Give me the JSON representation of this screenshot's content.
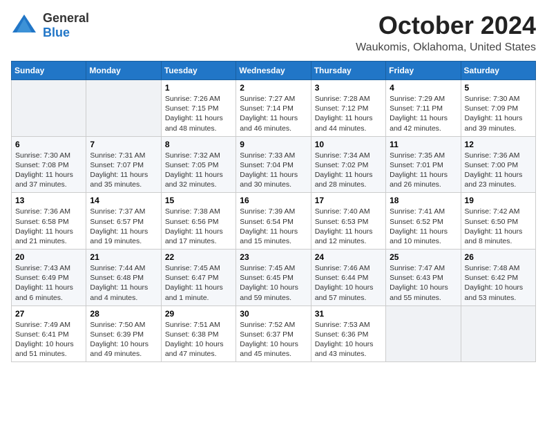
{
  "logo": {
    "general": "General",
    "blue": "Blue"
  },
  "title": "October 2024",
  "location": "Waukomis, Oklahoma, United States",
  "days_of_week": [
    "Sunday",
    "Monday",
    "Tuesday",
    "Wednesday",
    "Thursday",
    "Friday",
    "Saturday"
  ],
  "weeks": [
    [
      {
        "day": "",
        "info": ""
      },
      {
        "day": "",
        "info": ""
      },
      {
        "day": "1",
        "info": "Sunrise: 7:26 AM\nSunset: 7:15 PM\nDaylight: 11 hours and 48 minutes."
      },
      {
        "day": "2",
        "info": "Sunrise: 7:27 AM\nSunset: 7:14 PM\nDaylight: 11 hours and 46 minutes."
      },
      {
        "day": "3",
        "info": "Sunrise: 7:28 AM\nSunset: 7:12 PM\nDaylight: 11 hours and 44 minutes."
      },
      {
        "day": "4",
        "info": "Sunrise: 7:29 AM\nSunset: 7:11 PM\nDaylight: 11 hours and 42 minutes."
      },
      {
        "day": "5",
        "info": "Sunrise: 7:30 AM\nSunset: 7:09 PM\nDaylight: 11 hours and 39 minutes."
      }
    ],
    [
      {
        "day": "6",
        "info": "Sunrise: 7:30 AM\nSunset: 7:08 PM\nDaylight: 11 hours and 37 minutes."
      },
      {
        "day": "7",
        "info": "Sunrise: 7:31 AM\nSunset: 7:07 PM\nDaylight: 11 hours and 35 minutes."
      },
      {
        "day": "8",
        "info": "Sunrise: 7:32 AM\nSunset: 7:05 PM\nDaylight: 11 hours and 32 minutes."
      },
      {
        "day": "9",
        "info": "Sunrise: 7:33 AM\nSunset: 7:04 PM\nDaylight: 11 hours and 30 minutes."
      },
      {
        "day": "10",
        "info": "Sunrise: 7:34 AM\nSunset: 7:02 PM\nDaylight: 11 hours and 28 minutes."
      },
      {
        "day": "11",
        "info": "Sunrise: 7:35 AM\nSunset: 7:01 PM\nDaylight: 11 hours and 26 minutes."
      },
      {
        "day": "12",
        "info": "Sunrise: 7:36 AM\nSunset: 7:00 PM\nDaylight: 11 hours and 23 minutes."
      }
    ],
    [
      {
        "day": "13",
        "info": "Sunrise: 7:36 AM\nSunset: 6:58 PM\nDaylight: 11 hours and 21 minutes."
      },
      {
        "day": "14",
        "info": "Sunrise: 7:37 AM\nSunset: 6:57 PM\nDaylight: 11 hours and 19 minutes."
      },
      {
        "day": "15",
        "info": "Sunrise: 7:38 AM\nSunset: 6:56 PM\nDaylight: 11 hours and 17 minutes."
      },
      {
        "day": "16",
        "info": "Sunrise: 7:39 AM\nSunset: 6:54 PM\nDaylight: 11 hours and 15 minutes."
      },
      {
        "day": "17",
        "info": "Sunrise: 7:40 AM\nSunset: 6:53 PM\nDaylight: 11 hours and 12 minutes."
      },
      {
        "day": "18",
        "info": "Sunrise: 7:41 AM\nSunset: 6:52 PM\nDaylight: 11 hours and 10 minutes."
      },
      {
        "day": "19",
        "info": "Sunrise: 7:42 AM\nSunset: 6:50 PM\nDaylight: 11 hours and 8 minutes."
      }
    ],
    [
      {
        "day": "20",
        "info": "Sunrise: 7:43 AM\nSunset: 6:49 PM\nDaylight: 11 hours and 6 minutes."
      },
      {
        "day": "21",
        "info": "Sunrise: 7:44 AM\nSunset: 6:48 PM\nDaylight: 11 hours and 4 minutes."
      },
      {
        "day": "22",
        "info": "Sunrise: 7:45 AM\nSunset: 6:47 PM\nDaylight: 11 hours and 1 minute."
      },
      {
        "day": "23",
        "info": "Sunrise: 7:45 AM\nSunset: 6:45 PM\nDaylight: 10 hours and 59 minutes."
      },
      {
        "day": "24",
        "info": "Sunrise: 7:46 AM\nSunset: 6:44 PM\nDaylight: 10 hours and 57 minutes."
      },
      {
        "day": "25",
        "info": "Sunrise: 7:47 AM\nSunset: 6:43 PM\nDaylight: 10 hours and 55 minutes."
      },
      {
        "day": "26",
        "info": "Sunrise: 7:48 AM\nSunset: 6:42 PM\nDaylight: 10 hours and 53 minutes."
      }
    ],
    [
      {
        "day": "27",
        "info": "Sunrise: 7:49 AM\nSunset: 6:41 PM\nDaylight: 10 hours and 51 minutes."
      },
      {
        "day": "28",
        "info": "Sunrise: 7:50 AM\nSunset: 6:39 PM\nDaylight: 10 hours and 49 minutes."
      },
      {
        "day": "29",
        "info": "Sunrise: 7:51 AM\nSunset: 6:38 PM\nDaylight: 10 hours and 47 minutes."
      },
      {
        "day": "30",
        "info": "Sunrise: 7:52 AM\nSunset: 6:37 PM\nDaylight: 10 hours and 45 minutes."
      },
      {
        "day": "31",
        "info": "Sunrise: 7:53 AM\nSunset: 6:36 PM\nDaylight: 10 hours and 43 minutes."
      },
      {
        "day": "",
        "info": ""
      },
      {
        "day": "",
        "info": ""
      }
    ]
  ]
}
